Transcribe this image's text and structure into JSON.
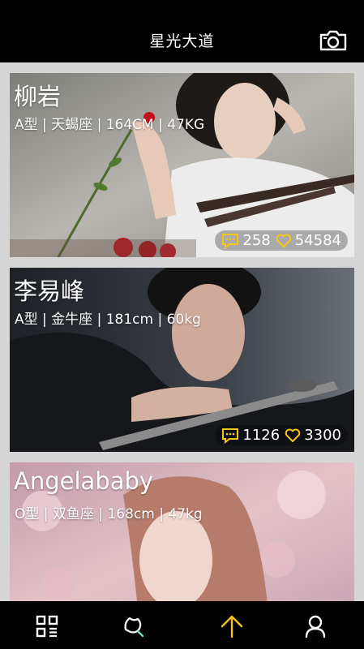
{
  "header": {
    "title": "星光大道",
    "camera_icon": "camera-icon"
  },
  "cards": [
    {
      "name": "柳岩",
      "info": "A型 | 天蝎座 | 164CM | 47KG",
      "comments": "258",
      "likes": "54584",
      "image": "photo of woman resting head on hand with red roses and film strip"
    },
    {
      "name": "李易峰",
      "info": "A型 | 金牛座 | 181cm | 60kg",
      "comments": "1126",
      "likes": "3300",
      "image": "photo of man leaning on hand in dark suit"
    },
    {
      "name": "Angelababy",
      "info": "O型 | 双鱼座 | 168cm | 47kg",
      "image": "photo of woman with flowers in soft pink light"
    }
  ],
  "tabbar": {
    "items": [
      "grid-icon",
      "leaf-search-icon",
      "arrow-up-icon",
      "user-icon"
    ],
    "active_color": "#f5c518"
  },
  "colors": {
    "accent": "#f5c518",
    "header_bg": "#000000",
    "page_bg": "#d6d6d6"
  }
}
